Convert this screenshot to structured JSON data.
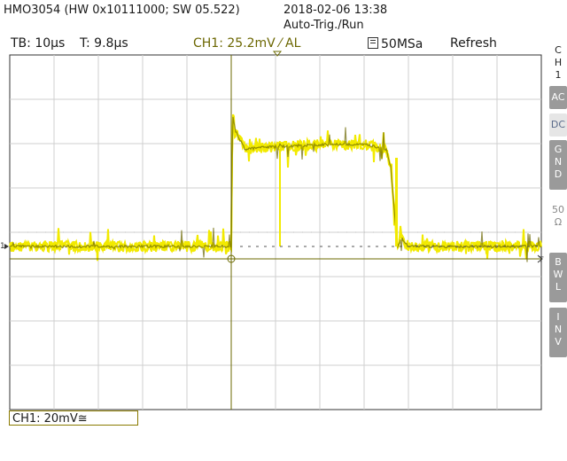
{
  "header": {
    "device": "HMO3054 (HW 0x10111000; SW 05.522)",
    "datetime": "2018-02-06 13:38",
    "trigger_status": "Auto-Trig./Run"
  },
  "info": {
    "timebase": "TB: 10µs",
    "trigger_time": "T: 9.8µs",
    "channel_trigger": "CH1: 25.2mV ⁄ AL",
    "sample_rate": "50MSa",
    "acq_mode": "Refresh"
  },
  "side_menu": {
    "channel": [
      "C",
      "H",
      "1"
    ],
    "ac": "AC",
    "dc": "DC",
    "gnd": [
      "G",
      "N",
      "D"
    ],
    "ohm": [
      "50",
      "Ω"
    ],
    "bwl": [
      "B",
      "W",
      "L"
    ],
    "inv": [
      "I",
      "N",
      "V"
    ]
  },
  "channel_scale": "CH1: 20mV≅",
  "markers": {
    "ground_marker": "1",
    "trigger_marker": "T"
  },
  "colors": {
    "trace": "#f2ea00",
    "trace_dark": "#6b6600",
    "grid": "#cfcfcf",
    "trigger_line": "#6b6a00"
  },
  "chart_data": {
    "type": "line",
    "title": "",
    "xlabel": "",
    "ylabel": "",
    "x_divisions": 12,
    "y_divisions": 8,
    "x_unit": "µs",
    "x_per_div": 10,
    "y_per_div_mV": 20,
    "series": [
      {
        "x": [
          -50,
          -20,
          0,
          0.3,
          1,
          3,
          10,
          20,
          30,
          35,
          36,
          37.5,
          38.5,
          40,
          50,
          60,
          70
        ],
        "y_div": [
          -1.2,
          -1.2,
          -1.2,
          1.8,
          1.4,
          1.0,
          1.05,
          1.1,
          1.1,
          1.0,
          0.6,
          -1.2,
          -1.0,
          -1.2,
          -1.2,
          -1.2,
          -1.2
        ]
      }
    ],
    "trigger_level_div": 0
  }
}
